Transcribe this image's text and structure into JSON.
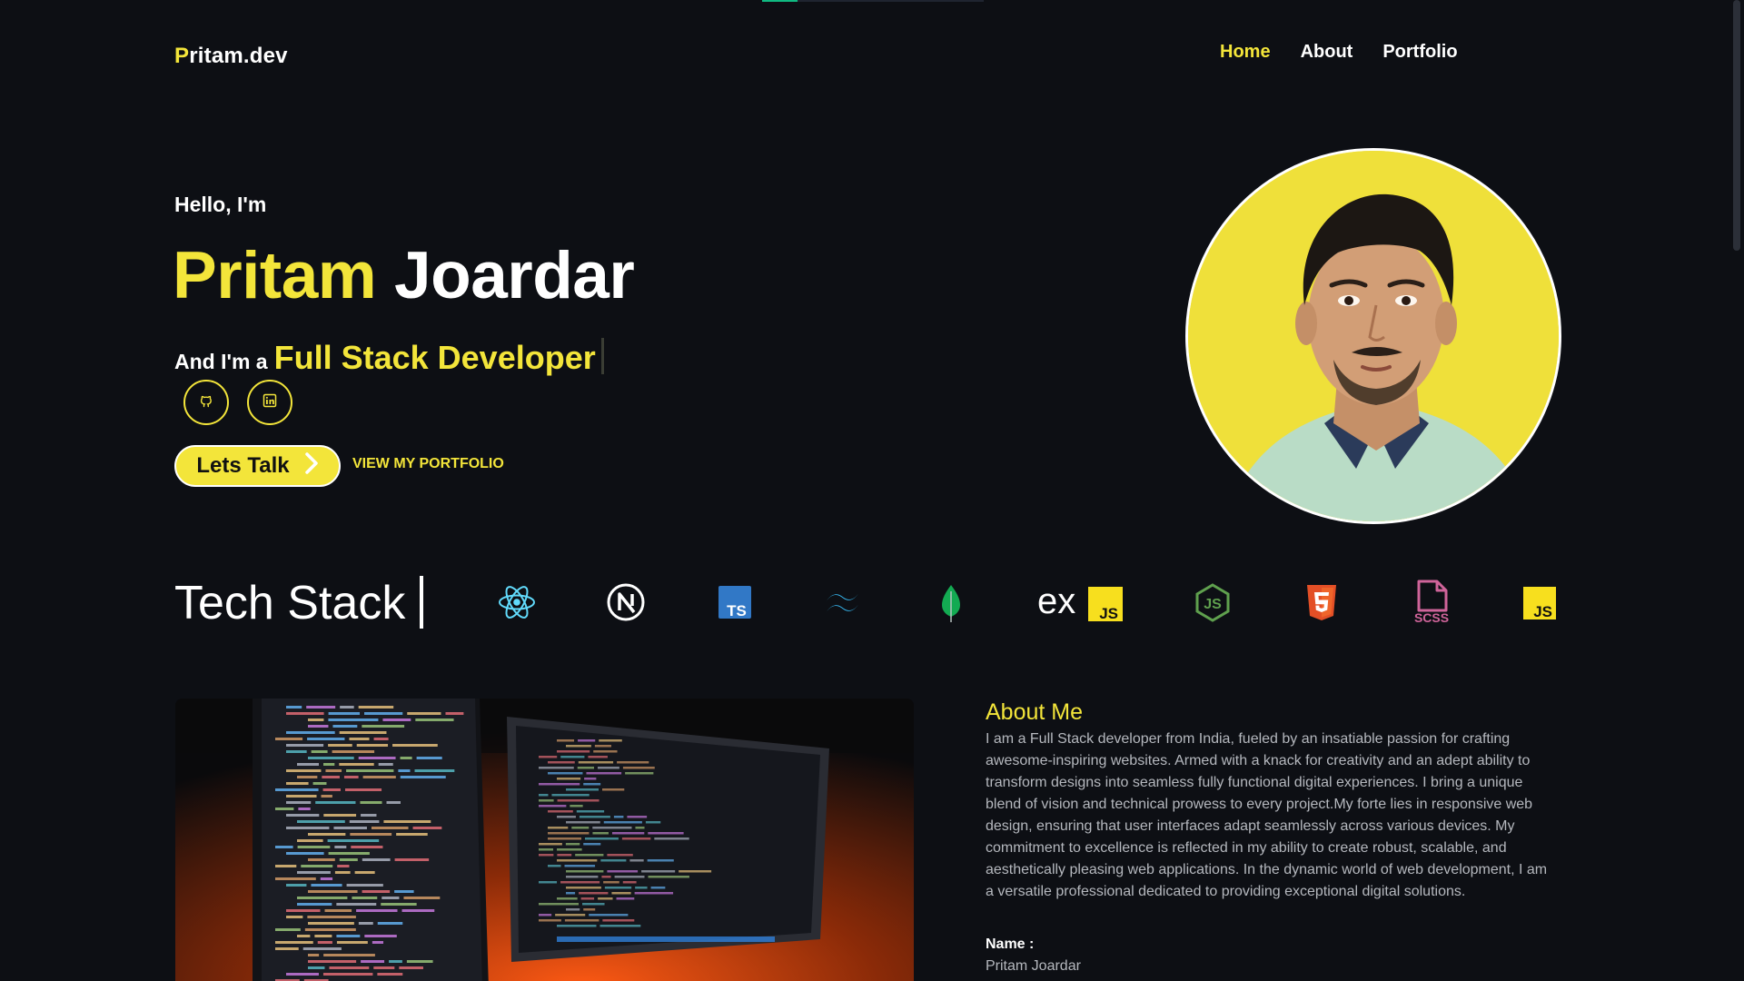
{
  "header": {
    "logo_prefix": "P",
    "logo_rest": "ritam.dev",
    "nav": [
      {
        "label": "Home",
        "active": true
      },
      {
        "label": "About",
        "active": false
      },
      {
        "label": "Portfolio",
        "active": false
      }
    ]
  },
  "hero": {
    "greeting": "Hello, I'm",
    "first_name": "Pritam",
    "last_name": "Joardar",
    "role_prefix": "And I'm a",
    "role_typed": "Full Stack Developer",
    "social": [
      {
        "icon": "github-icon"
      },
      {
        "icon": "linkedin-icon"
      }
    ],
    "primary_button": "Lets Talk",
    "secondary_link": "VIEW MY PORTFOLIO"
  },
  "tech_stack": {
    "title": "Tech Stack",
    "icons": [
      {
        "name": "react-icon",
        "color": "#61dafb"
      },
      {
        "name": "nextjs-icon",
        "color": "#ffffff"
      },
      {
        "name": "typescript-icon",
        "color": "#3178c6",
        "text": "TS"
      },
      {
        "name": "tailwind-icon",
        "color": "#38bdf8"
      },
      {
        "name": "mongodb-icon",
        "color": "#13aa52"
      },
      {
        "name": "expressjs-icon",
        "color": "#ffffff",
        "text": "ex",
        "badge": "JS"
      },
      {
        "name": "nodejs-icon",
        "color": "#5fa04e",
        "text": "JS"
      },
      {
        "name": "html5-icon",
        "color": "#e34f26",
        "text": "5"
      },
      {
        "name": "scss-icon",
        "color": "#cf649a",
        "text": "SCSS"
      },
      {
        "name": "javascript-icon",
        "color": "#f7df1e",
        "text": "JS"
      }
    ]
  },
  "about": {
    "title": "About Me",
    "body": "I am a Full Stack developer from India, fueled by an insatiable passion for crafting awesome-inspiring websites. Armed with a knack for creativity and an adept ability to transform designs into seamless fully functional digital experiences. I bring a unique blend of vision and technical prowess to every project.My forte lies in responsive web design, ensuring that user interfaces adapt seamlessly across various devices. My commitment to excellence is reflected in my ability to create robust, scalable, and aesthetically pleasing web applications. In the dynamic world of web development, I am a versatile professional dedicated to providing exceptional digital solutions.",
    "name_label": "Name :",
    "name_value": "Pritam Joardar"
  },
  "colors": {
    "background": "#0d0f14",
    "accent": "#f3e53a",
    "muted_text": "#b5b8be",
    "progress": "#10b981"
  },
  "page_progress": 0.16
}
